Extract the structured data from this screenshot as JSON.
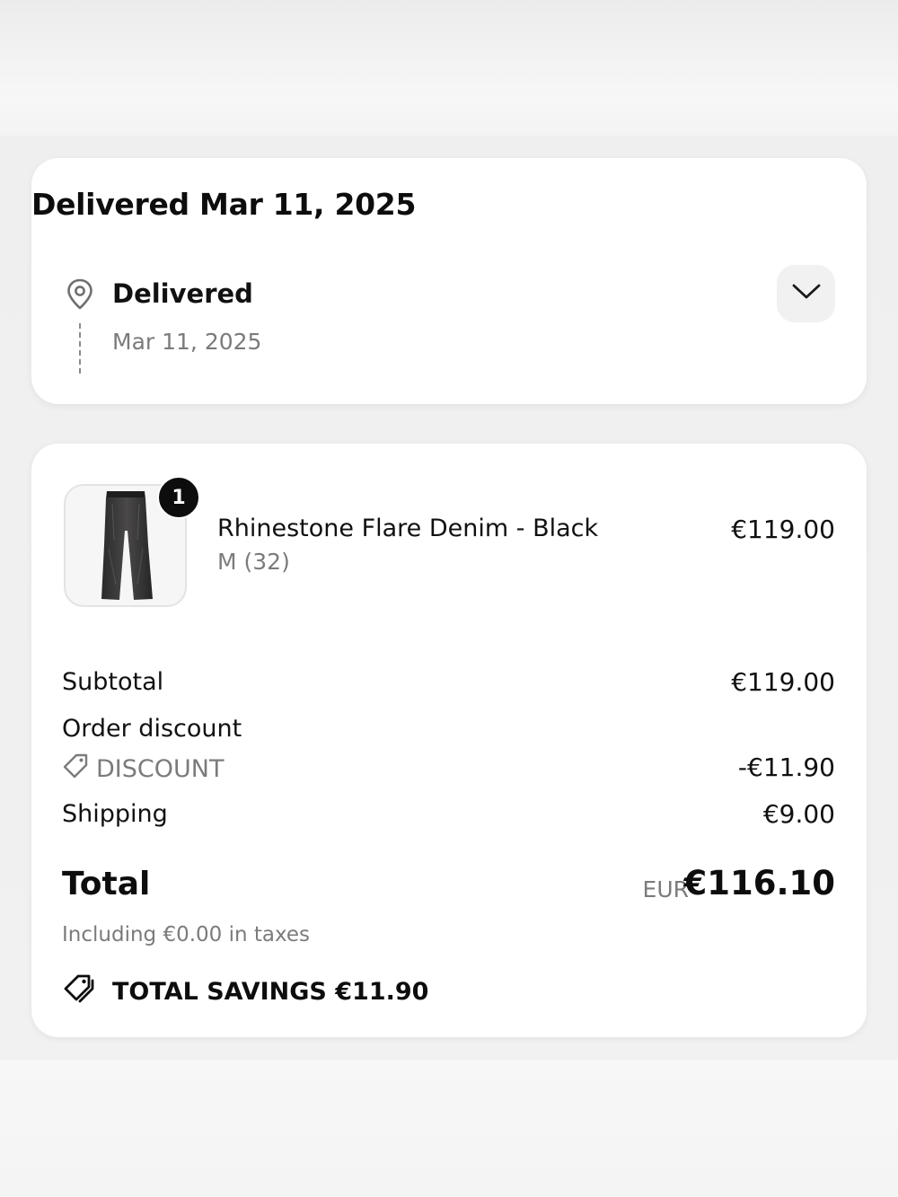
{
  "delivery": {
    "title": "Delivered Mar 11, 2025",
    "status_label": "Delivered",
    "status_date": "Mar 11, 2025"
  },
  "order": {
    "item": {
      "name": "Rhinestone Flare Denim - Black",
      "variant": "M (32)",
      "price": "€119.00",
      "quantity": "1"
    },
    "summary": {
      "subtotal_label": "Subtotal",
      "subtotal_value": "€119.00",
      "discount_label": "Order discount",
      "discount_code": "DISCOUNT",
      "discount_value": "-€11.90",
      "shipping_label": "Shipping",
      "shipping_value": "€9.00"
    },
    "total": {
      "label": "Total",
      "currency": "EUR",
      "amount": "€116.10",
      "taxes_note": "Including €0.00 in taxes",
      "savings": "TOTAL SAVINGS €11.90"
    }
  },
  "icons": {
    "status": "location-pin-icon",
    "expand": "chevron-down-icon",
    "discount": "tag-icon",
    "savings": "tags-icon"
  }
}
